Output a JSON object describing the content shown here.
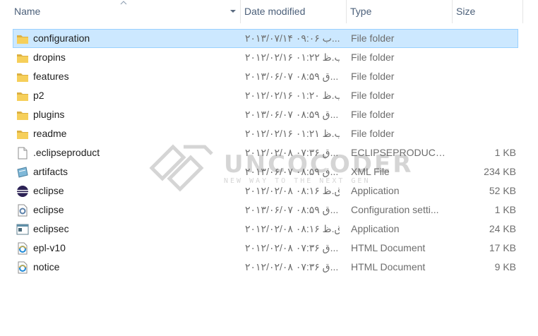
{
  "columns": {
    "name": "Name",
    "date": "Date modified",
    "type": "Type",
    "size": "Size"
  },
  "files": [
    {
      "name": "configuration",
      "date": "۲۰۱۳/۰۷/۱۴ ب ۰۹:۰۶...",
      "type": "File folder",
      "size": "",
      "icon": "folder-icon",
      "selected": true
    },
    {
      "name": "dropins",
      "date": "۲۰۱۲/۰۲/۱۶ ب.ظ ۰۱:۲۲",
      "type": "File folder",
      "size": "",
      "icon": "folder-icon"
    },
    {
      "name": "features",
      "date": "۲۰۱۳/۰۶/۰۷ ق ۰۸:۵۹...",
      "type": "File folder",
      "size": "",
      "icon": "folder-icon"
    },
    {
      "name": "p2",
      "date": "۲۰۱۲/۰۲/۱۶ ب.ظ ۰۱:۲۰",
      "type": "File folder",
      "size": "",
      "icon": "folder-icon"
    },
    {
      "name": "plugins",
      "date": "۲۰۱۳/۰۶/۰۷ ق ۰۸:۵۹...",
      "type": "File folder",
      "size": "",
      "icon": "folder-icon"
    },
    {
      "name": "readme",
      "date": "۲۰۱۲/۰۲/۱۶ ب.ظ ۰۱:۲۱",
      "type": "File folder",
      "size": "",
      "icon": "folder-icon"
    },
    {
      "name": ".eclipseproduct",
      "date": "۲۰۱۲/۰۲/۰۸ ق ۰۷:۳۶...",
      "type": "ECLIPSEPRODUCT ...",
      "size": "1 KB",
      "icon": "blank-file-icon"
    },
    {
      "name": "artifacts",
      "date": "۲۰۱۳/۰۶/۰۷ ق ۰۸:۵۹...",
      "type": "XML File",
      "size": "234 KB",
      "icon": "xml-file-icon"
    },
    {
      "name": "eclipse",
      "date": "۲۰۱۲/۰۲/۰۸ ق.ظ ۰۸:۱۶",
      "type": "Application",
      "size": "52 KB",
      "icon": "eclipse-app-icon"
    },
    {
      "name": "eclipse",
      "date": "۲۰۱۳/۰۶/۰۷ ق ۰۸:۵۹...",
      "type": "Configuration setti...",
      "size": "1 KB",
      "icon": "settings-file-icon"
    },
    {
      "name": "eclipsec",
      "date": "۲۰۱۲/۰۲/۰۸ ق.ظ ۰۸:۱۶",
      "type": "Application",
      "size": "24 KB",
      "icon": "console-app-icon"
    },
    {
      "name": "epl-v10",
      "date": "۲۰۱۲/۰۲/۰۸ ق ۰۷:۳۶...",
      "type": "HTML Document",
      "size": "17 KB",
      "icon": "ie-document-icon"
    },
    {
      "name": "notice",
      "date": "۲۰۱۲/۰۲/۰۸ ق ۰۷:۳۶...",
      "type": "HTML Document",
      "size": "9 KB",
      "icon": "ie-document-icon"
    }
  ],
  "watermark": {
    "title": "UNCOCODER",
    "subtitle": "NEW WAY TO THE NEXT GEN"
  },
  "colors": {
    "selection_bg": "#cce8ff",
    "selection_border": "#99d1ff",
    "header_text": "#4c607a",
    "secondary_text": "#6d6d6d",
    "folder": "#f2c94c"
  }
}
